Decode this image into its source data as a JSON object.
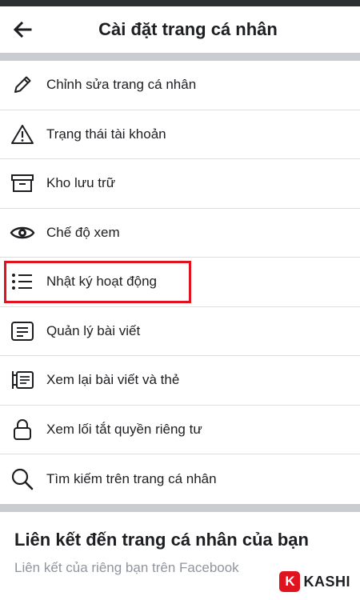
{
  "header": {
    "title": "Cài đặt trang cá nhân",
    "back_icon": "arrow-left-icon"
  },
  "menu": {
    "items": [
      {
        "label": "Chỉnh sửa trang cá nhân",
        "icon": "pencil-icon"
      },
      {
        "label": "Trạng thái tài khoản",
        "icon": "warning-icon"
      },
      {
        "label": "Kho lưu trữ",
        "icon": "archive-icon"
      },
      {
        "label": "Chế độ xem",
        "icon": "eye-icon"
      },
      {
        "label": "Nhật ký hoạt động",
        "icon": "list-icon",
        "highlighted": true
      },
      {
        "label": "Quản lý bài viết",
        "icon": "message-icon"
      },
      {
        "label": "Xem lại bài viết và thẻ",
        "icon": "review-icon"
      },
      {
        "label": "Xem lối tắt quyền riêng tư",
        "icon": "lock-icon"
      },
      {
        "label": "Tìm kiếm trên trang cá nhân",
        "icon": "search-icon"
      }
    ]
  },
  "link_section": {
    "title": "Liên kết đến trang cá nhân của bạn",
    "subtitle": "Liên kết của riêng bạn trên Facebook"
  },
  "watermark": {
    "badge": "K",
    "text": "KASHI"
  },
  "colors": {
    "highlight": "#e0141e",
    "divider": "#c9ccd1",
    "text": "#1c1e21",
    "muted": "#90949c"
  }
}
